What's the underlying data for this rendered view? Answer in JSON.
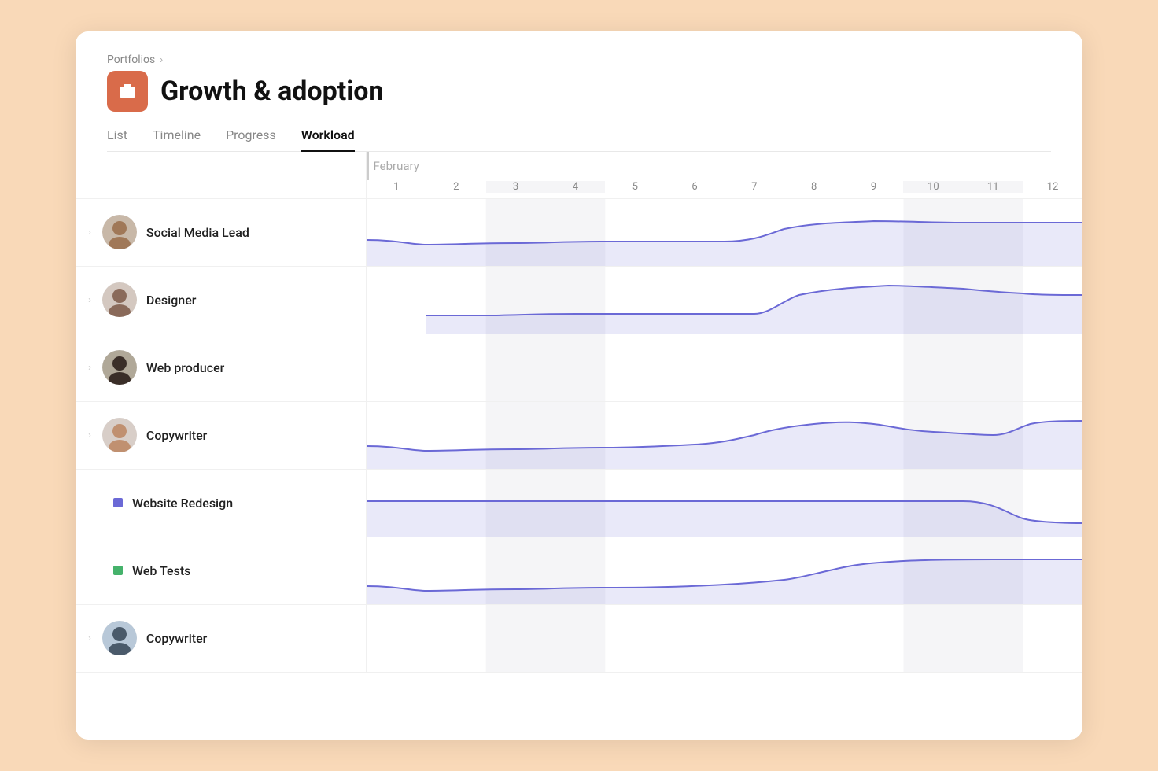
{
  "app": {
    "breadcrumb": "Portfolios",
    "title": "Growth & adoption",
    "tabs": [
      "List",
      "Timeline",
      "Progress",
      "Workload"
    ],
    "active_tab": "Workload"
  },
  "timeline": {
    "month": "February",
    "days": [
      1,
      2,
      3,
      4,
      5,
      6,
      7,
      8,
      9,
      10,
      11,
      12
    ],
    "weekend_days": [
      3,
      4,
      10,
      11
    ]
  },
  "rows": [
    {
      "type": "person",
      "name": "Social Media Lead",
      "avatar_seed": "social"
    },
    {
      "type": "person",
      "name": "Designer",
      "avatar_seed": "designer"
    },
    {
      "type": "person",
      "name": "Web producer",
      "avatar_seed": "webproducer"
    },
    {
      "type": "person",
      "name": "Copywriter",
      "avatar_seed": "copywriter"
    },
    {
      "type": "task",
      "name": "Website Redesign",
      "color": "#6b69d6"
    },
    {
      "type": "task",
      "name": "Web Tests",
      "color": "#45b26b"
    },
    {
      "type": "person",
      "name": "Copywriter",
      "avatar_seed": "copywriter2"
    }
  ],
  "colors": {
    "chart_line": "#6b69d6",
    "chart_fill": "rgba(107,105,214,0.15)",
    "weekend_bg": "#f5f5f7",
    "accent": "#d96b4a"
  }
}
